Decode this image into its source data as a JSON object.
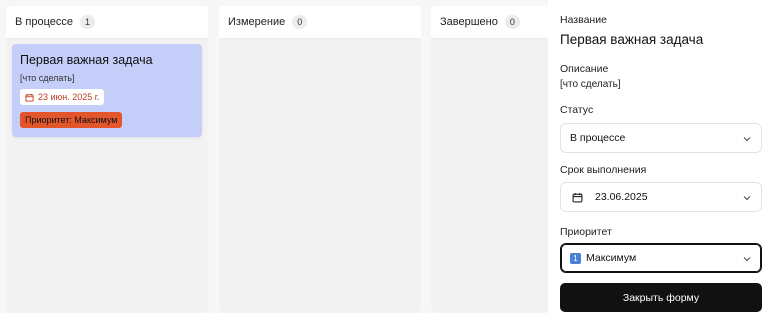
{
  "columns": [
    {
      "title": "В процессе",
      "count": "1"
    },
    {
      "title": "Измерение",
      "count": "0"
    },
    {
      "title": "Завершено",
      "count": "0"
    }
  ],
  "card": {
    "title": "Первая важная задача",
    "description": "[что сделать]",
    "due_date": "23 июн. 2025 г.",
    "priority": "Приоритет: Максимум",
    "colors": {
      "background": "#c5cef9",
      "priority": "#e3562c",
      "date_text": "#c03a1e"
    }
  },
  "form": {
    "title_label": "Название",
    "title_value": "Первая важная задача",
    "description_label": "Описание",
    "description_value": "[что сделать]",
    "status_label": "Статус",
    "status_value": "В процессе",
    "due_label": "Срок выполнения",
    "due_value": "23.06.2025",
    "priority_label": "Приоритет",
    "priority_badge": "1",
    "priority_value": "Максимум",
    "close_button": "Закрыть форму"
  },
  "icons": {
    "calendar": "calendar-icon",
    "chevron": "chevron-down-icon",
    "priority_number": "keycap-one-icon"
  }
}
